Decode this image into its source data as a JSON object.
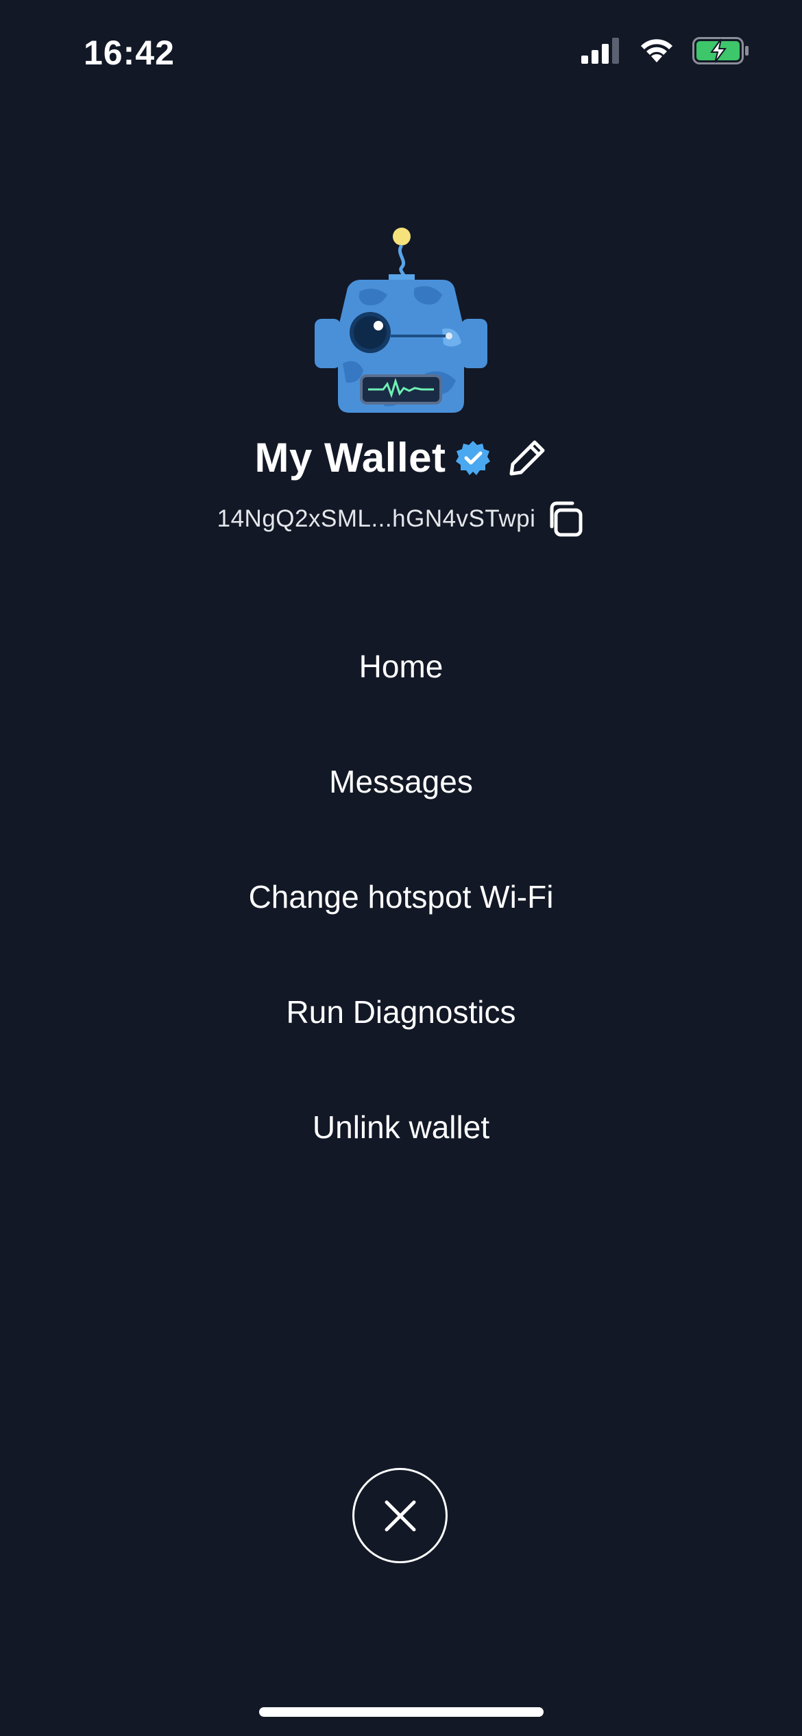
{
  "status_bar": {
    "time": "16:42",
    "icons": [
      "cellular-signal-icon",
      "wifi-icon",
      "battery-charging-icon"
    ],
    "battery_color": "#3ec66a"
  },
  "profile": {
    "avatar_icon": "robot-avatar-icon",
    "wallet_name": "My Wallet",
    "verified_icon": "verified-badge-icon",
    "verified_color": "#4aa8f0",
    "edit_icon": "pencil-icon",
    "address": "14NgQ2xSML...hGN4vSTwpi",
    "copy_icon": "copy-icon"
  },
  "menu": {
    "items": [
      {
        "label": "Home"
      },
      {
        "label": "Messages"
      },
      {
        "label": "Change hotspot Wi-Fi"
      },
      {
        "label": "Run Diagnostics"
      },
      {
        "label": "Unlink wallet"
      }
    ]
  },
  "close": {
    "icon": "close-icon"
  },
  "theme": {
    "background": "#121826",
    "avatar_blue": "#4a90d9"
  }
}
